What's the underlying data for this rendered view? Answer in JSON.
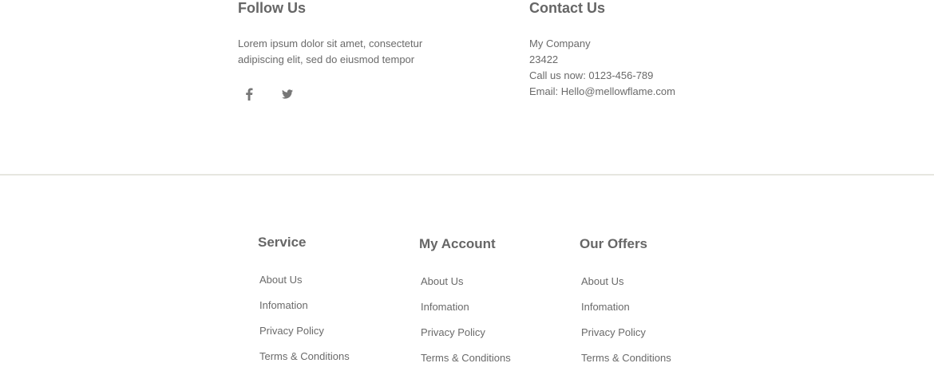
{
  "follow": {
    "title": "Follow Us",
    "text_line1": "Lorem ipsum dolor sit amet, consectetur",
    "text_line2": "adipiscing elit, sed do eiusmod tempor",
    "social": [
      "facebook-icon",
      "twitter-icon"
    ]
  },
  "contact": {
    "title": "Contact Us",
    "company": "My Company",
    "zip": "23422",
    "phone": "Call us now: 0123-456-789",
    "email": "Email: Hello@mellowflame.com"
  },
  "footer": {
    "service": {
      "title": "Service",
      "links": [
        "About Us",
        "Infomation",
        "Privacy Policy",
        "Terms & Conditions"
      ]
    },
    "account": {
      "title": "My Account",
      "links": [
        "About Us",
        "Infomation",
        "Privacy Policy",
        "Terms & Conditions"
      ]
    },
    "offers": {
      "title": "Our Offers",
      "links": [
        "About Us",
        "Infomation",
        "Privacy Policy",
        "Terms & Conditions"
      ]
    }
  },
  "colors": {
    "text": "#6a6a6a",
    "heading": "#666666",
    "divider": "#e6e6e0"
  }
}
